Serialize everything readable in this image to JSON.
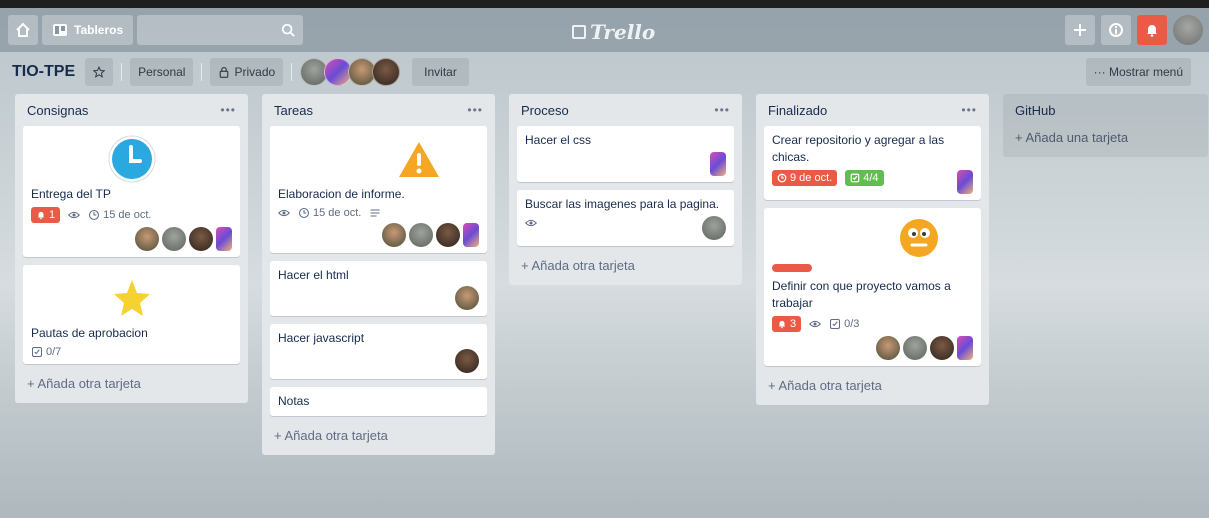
{
  "header": {
    "boards_label": "Tableros",
    "logo_text": "Trello"
  },
  "board": {
    "title": "TIO-TPE",
    "team": "Personal",
    "visibility": "Privado",
    "invite_label": "Invitar",
    "menu_label": "··· Mostrar menú"
  },
  "lists": {
    "consignas": {
      "title": "Consignas",
      "add_label": "+ Añada otra tarjeta",
      "card1": {
        "title": "Entrega del TP",
        "notif_count": "1",
        "due": "15 de oct."
      },
      "card2": {
        "title": "Pautas de aprobacion",
        "checklist": "0/7"
      }
    },
    "tareas": {
      "title": "Tareas",
      "add_label": "+ Añada otra tarjeta",
      "card1": {
        "title": "Elaboracion de informe.",
        "due": "15 de oct."
      },
      "card2": {
        "title": "Hacer el html"
      },
      "card3": {
        "title": "Hacer javascript"
      },
      "card4": {
        "title": "Notas"
      }
    },
    "proceso": {
      "title": "Proceso",
      "add_label": "+ Añada otra tarjeta",
      "card1": {
        "title": "Hacer el css"
      },
      "card2": {
        "title": "Buscar las imagenes para la pagina."
      }
    },
    "finalizado": {
      "title": "Finalizado",
      "add_label": "+ Añada otra tarjeta",
      "card1": {
        "title": "Crear repositorio y agregar a las chicas.",
        "due": "9 de oct.",
        "checklist": "4/4"
      },
      "card2": {
        "title": "Definir con que proyecto vamos a trabajar",
        "notif_count": "3",
        "checklist": "0/3"
      }
    },
    "github": {
      "title": "GitHub",
      "add_label": "+ Añada una tarjeta"
    }
  },
  "colors": {
    "red": "#eb5a46",
    "green": "#61bd4f",
    "list_bg": "#e4e7ea"
  }
}
